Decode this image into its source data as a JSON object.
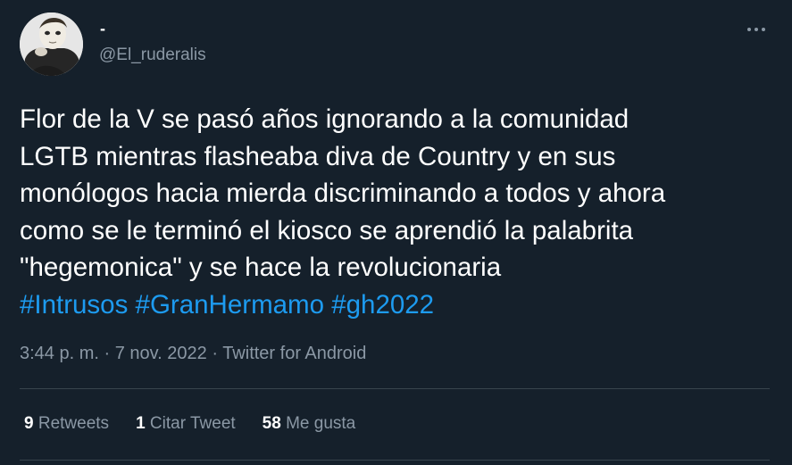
{
  "author": {
    "display_name": "-",
    "handle": "@El_ruderalis"
  },
  "tweet": {
    "lines": [
      "Flor de la V se pasó años ignorando a la comunidad",
      "LGTB mientras flasheaba diva de Country y en sus",
      "monólogos hacia mierda discriminando a todos y ahora",
      "como se le terminó el kiosco se aprendió la palabrita",
      "\"hegemonica\" y se hace la revolucionaria"
    ],
    "hashtags": [
      "#Intrusos",
      "#GranHermamo",
      "#gh2022"
    ]
  },
  "meta": {
    "time": "3:44 p. m.",
    "sep1": " · ",
    "date": "7 nov. 2022",
    "sep2": " · ",
    "source": "Twitter for Android"
  },
  "stats": {
    "retweets_count": "9",
    "retweets_label": "Retweets",
    "quotes_count": "1",
    "quotes_label": "Citar Tweet",
    "likes_count": "58",
    "likes_label": "Me gusta"
  },
  "icons": {
    "more": "more-horizontal-icon"
  },
  "colors": {
    "background": "#15202b",
    "text": "#ffffff",
    "secondary": "#8b98a5",
    "link": "#1d9bf0",
    "divider": "#38444d"
  }
}
